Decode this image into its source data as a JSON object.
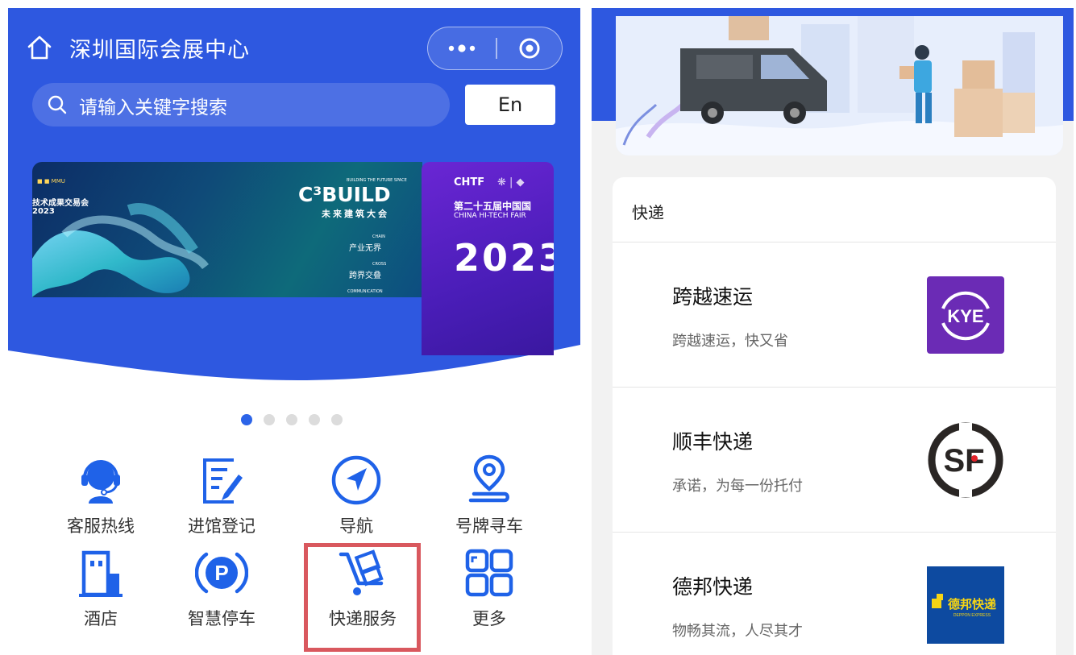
{
  "header": {
    "title": "深圳国际会展中心",
    "home_icon": "home-icon",
    "more_icon": "more-dots-icon",
    "close_icon": "target-close-icon"
  },
  "search": {
    "placeholder": "请输入关键字搜索",
    "lang_button": "En"
  },
  "banners": [
    {
      "left_text_1": "技术成果交易会",
      "left_text_2": "2023",
      "brand_top": "BUILDING THE FUTURE SPACE",
      "brand": "C³BUILD",
      "brand_sub": "未来建筑大会",
      "chain_en": "CHAIN",
      "chain": "产业无界",
      "cross_en": "CROSS",
      "cross": "跨界交叠",
      "communication_en": "COMMUNICATION"
    },
    {
      "logo": "CHTF",
      "title_cn": "第二十五届中国国",
      "title_en": "CHINA HI-TECH FAIR",
      "year": "2023"
    }
  ],
  "carousel": {
    "count": 5,
    "active": 0
  },
  "grid": [
    {
      "label": "客服热线",
      "icon": "headset-icon"
    },
    {
      "label": "进馆登记",
      "icon": "register-form-icon"
    },
    {
      "label": "导航",
      "icon": "navigation-arrow-icon"
    },
    {
      "label": "号牌寻车",
      "icon": "location-pin-icon"
    },
    {
      "label": "酒店",
      "icon": "hotel-building-icon"
    },
    {
      "label": "智慧停车",
      "icon": "parking-icon"
    },
    {
      "label": "快递服务",
      "icon": "delivery-cart-icon"
    },
    {
      "label": "更多",
      "icon": "grid-more-icon"
    }
  ],
  "highlight_color": "#d9585e",
  "colors": {
    "brand_blue": "#2e58e0",
    "kye_purple": "#6b2bb5",
    "deppon_blue": "#0d4aa0",
    "deppon_yellow": "#f5d414"
  },
  "express": {
    "section_title": "快递",
    "items": [
      {
        "name": "跨越速运",
        "desc": "跨越速运，快又省",
        "logo_text": "KYE",
        "logo_icon": "kye-logo-icon"
      },
      {
        "name": "顺丰快递",
        "desc": "承诺，为每一份托付",
        "logo_text": "SF",
        "logo_icon": "sf-logo-icon"
      },
      {
        "name": "德邦快递",
        "desc": "物畅其流，人尽其才",
        "logo_text": "德邦快递",
        "logo_sub": "DEPPON EXPRESS",
        "logo_icon": "deppon-logo-icon"
      }
    ]
  }
}
